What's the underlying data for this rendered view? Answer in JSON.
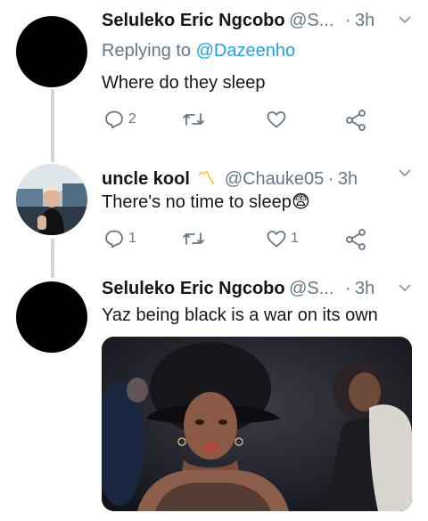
{
  "tweets": [
    {
      "name": "Seluleko Eric Ngcobo",
      "handle": "@S...",
      "separator": "·",
      "time": "3h",
      "reply_prefix": "Replying to",
      "reply_to": "@Dazeenho",
      "text": "Where do they sleep",
      "counts": {
        "reply": "2",
        "retweet": "",
        "like": ""
      }
    },
    {
      "name": "uncle kool",
      "emoji": "〽",
      "handle": "@Chauke05",
      "separator": "·",
      "time": "3h",
      "text": "There's no time to sleep😨",
      "counts": {
        "reply": "1",
        "retweet": "",
        "like": "1"
      }
    },
    {
      "name": "Seluleko Eric Ngcobo",
      "handle": "@S...",
      "separator": "·",
      "time": "3h",
      "text": "Yaz being black is a war on its own"
    }
  ],
  "icons": {
    "reply": "reply-icon",
    "retweet": "retweet-icon",
    "like": "heart-icon",
    "share": "share-icon",
    "more": "chevron-down-icon"
  },
  "colors": {
    "secondary": "#657786",
    "accent": "#1da1f2",
    "line": "#ccd6dd",
    "emoji": "#f5c518"
  }
}
